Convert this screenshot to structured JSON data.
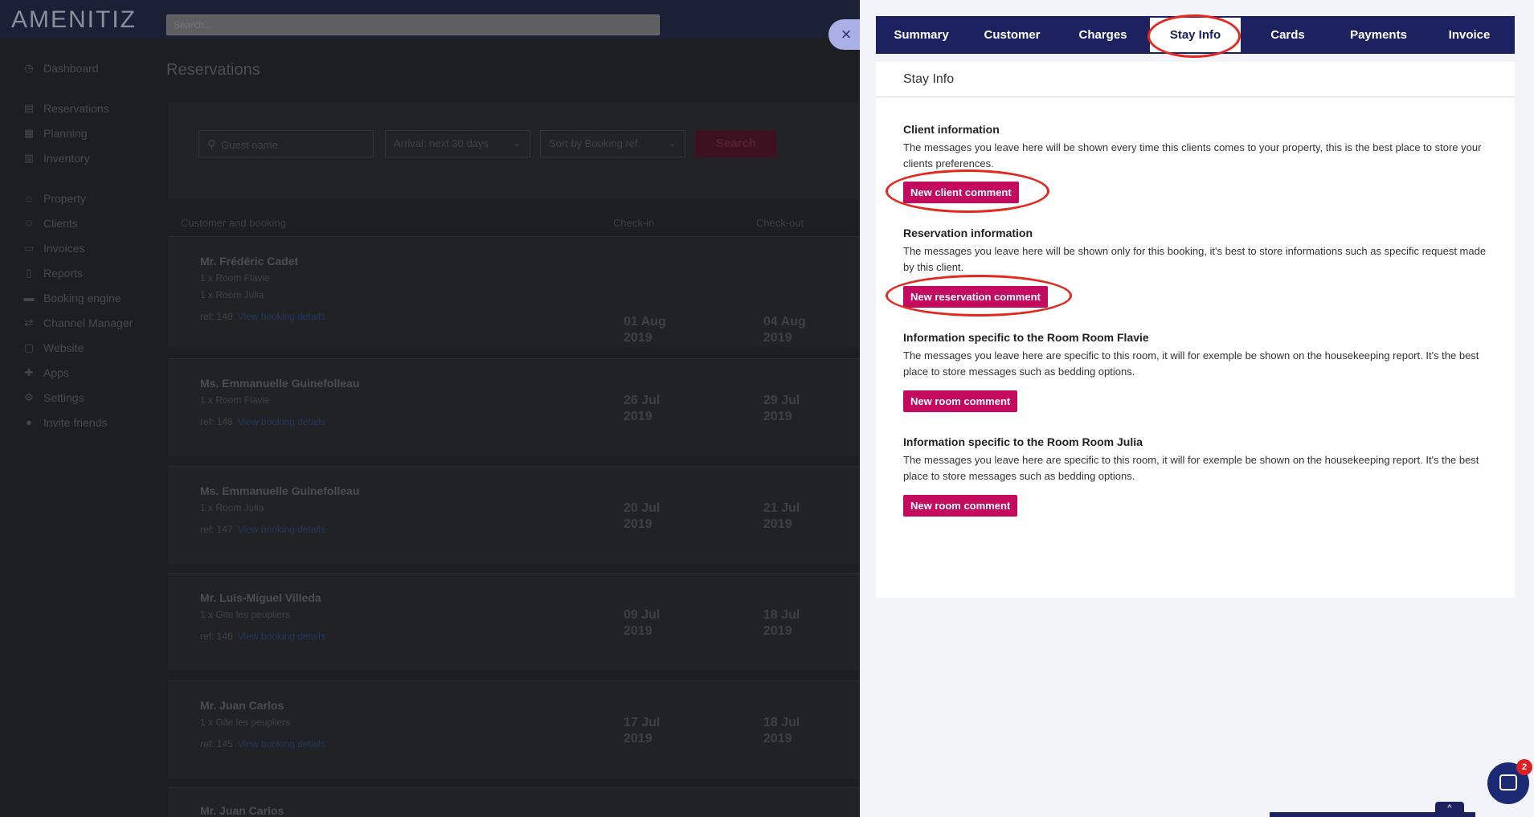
{
  "app": {
    "logo": "AMENITIZ",
    "search_placeholder": "Search..."
  },
  "sidebar": {
    "items": [
      {
        "label": "Dashboard",
        "icon": "dashboard-icon"
      },
      {
        "label": "Reservations",
        "icon": "reservations-icon"
      },
      {
        "label": "Planning",
        "icon": "planning-icon"
      },
      {
        "label": "Inventory",
        "icon": "inventory-icon"
      },
      {
        "label": "Property",
        "icon": "property-icon"
      },
      {
        "label": "Clients",
        "icon": "clients-icon"
      },
      {
        "label": "Invoices",
        "icon": "invoices-icon"
      },
      {
        "label": "Reports",
        "icon": "reports-icon"
      },
      {
        "label": "Booking engine",
        "icon": "booking-engine-icon"
      },
      {
        "label": "Channel Manager",
        "icon": "channel-manager-icon"
      },
      {
        "label": "Website",
        "icon": "website-icon"
      },
      {
        "label": "Apps",
        "icon": "apps-icon"
      },
      {
        "label": "Settings",
        "icon": "settings-icon"
      },
      {
        "label": "Invite friends",
        "icon": "invite-friends-icon"
      }
    ]
  },
  "reservations": {
    "title": "Reservations",
    "filters": {
      "guest_placeholder": "Guest name",
      "arrival": "Arrival: next 30 days",
      "sort": "Sort by Booking ref.",
      "search_label": "Search"
    },
    "columns": {
      "customer": "Customer and booking",
      "checkin": "Check-in",
      "checkout": "Check-out"
    },
    "view_link": "View booking details",
    "rows": [
      {
        "name": "Mr. Frédéric Cadet",
        "rooms": [
          "1 x Room Flavie",
          "1 x Room Julia"
        ],
        "ref": "ref: 149",
        "checkin_day": "01 Aug",
        "checkin_year": "2019",
        "checkout_day": "04 Aug",
        "checkout_year": "2019"
      },
      {
        "name": "Ms. Emmanuelle Guinefolleau",
        "rooms": [
          "1 x Room Flavie"
        ],
        "ref": "ref: 148",
        "checkin_day": "26 Jul",
        "checkin_year": "2019",
        "checkout_day": "29 Jul",
        "checkout_year": "2019"
      },
      {
        "name": "Ms. Emmanuelle Guinefolleau",
        "rooms": [
          "1 x Room Julia"
        ],
        "ref": "ref: 147",
        "checkin_day": "20 Jul",
        "checkin_year": "2019",
        "checkout_day": "21 Jul",
        "checkout_year": "2019"
      },
      {
        "name": "Mr. Luis-Miguel Villeda",
        "rooms": [
          "1 x Gite les peupliers"
        ],
        "ref": "ref: 146",
        "checkin_day": "09 Jul",
        "checkin_year": "2019",
        "checkout_day": "18 Jul",
        "checkout_year": "2019"
      },
      {
        "name": "Mr. Juan Carlos",
        "rooms": [
          "1 x Gite les peupliers"
        ],
        "ref": "ref: 145",
        "checkin_day": "17 Jul",
        "checkin_year": "2019",
        "checkout_day": "18 Jul",
        "checkout_year": "2019"
      },
      {
        "name": "Mr. Juan Carlos",
        "rooms": [],
        "ref": "",
        "checkin_day": "",
        "checkin_year": "",
        "checkout_day": "",
        "checkout_year": ""
      }
    ]
  },
  "drawer": {
    "close_symbol": "×",
    "tabs": [
      "Summary",
      "Customer",
      "Charges",
      "Stay Info",
      "Cards",
      "Payments",
      "Invoice"
    ],
    "active_tab": "Stay Info",
    "panel_title": "Stay Info",
    "sections": [
      {
        "title": "Client information",
        "description": "The messages you leave here will be shown every time this clients comes to your property, this is the best place to store your clients preferences.",
        "button": "New client comment"
      },
      {
        "title": "Reservation information",
        "description": "The messages you leave here will be shown only for this booking, it's best to store informations such as specific request made by this client.",
        "button": "New reservation comment"
      },
      {
        "title": "Information specific to the Room Room Flavie",
        "description": "The messages you leave here are specific to this room, it will for exemple be shown on the housekeeping report. It's the best place to store messages such as bedding options.",
        "button": "New room comment"
      },
      {
        "title": "Information specific to the Room Room Julia",
        "description": "The messages you leave here are specific to this room, it will for exemple be shown on the housekeeping report. It's the best place to store messages such as bedding options.",
        "button": "New room comment"
      }
    ]
  },
  "chat": {
    "badge_count": "2",
    "bottom_tab_symbol": "^"
  },
  "colors": {
    "navy": "#1c2260",
    "accent_pink": "#c30a5f",
    "highlight_red": "#e5281d"
  }
}
